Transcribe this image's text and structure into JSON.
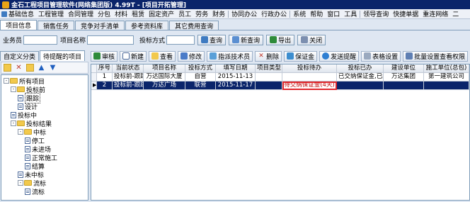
{
  "window": {
    "title": "金石工程项目管理软件(网络集团版) 4.99T - [项目开拓管理]"
  },
  "menu": [
    "基础信息",
    "工程管理",
    "合同管理",
    "分包",
    "材料",
    "租赁",
    "固定资产",
    "员工",
    "劳务",
    "财务",
    "协同办公",
    "行政办公",
    "系统",
    "帮助",
    "窗口",
    "工具",
    "领导查询",
    "快捷单据",
    "重连网络",
    "二"
  ],
  "main_tabs": [
    "项目信息",
    "销售任务",
    "竞争对手清单",
    "参考资料库",
    "其它费用查询"
  ],
  "search": {
    "staff_label": "业务员",
    "project_name_label": "项目名称",
    "bid_method_label": "投标方式",
    "query_button": "查询",
    "new_query_button": "新查询",
    "export_button": "导出",
    "close_button": "关闭"
  },
  "left_tabs": [
    "自定义分类",
    "待提醒的项目"
  ],
  "tree": [
    {
      "label": "所有项目",
      "level": 0,
      "type": "folder",
      "expander": "-"
    },
    {
      "label": "投标前",
      "level": 1,
      "type": "folder",
      "expander": "-"
    },
    {
      "label": "跟踪",
      "level": 2,
      "type": "doc",
      "selected": true
    },
    {
      "label": "设计",
      "level": 2,
      "type": "doc"
    },
    {
      "label": "投标中",
      "level": 1,
      "type": "doc"
    },
    {
      "label": "投标结果",
      "level": 1,
      "type": "folder",
      "expander": "-"
    },
    {
      "label": "中标",
      "level": 2,
      "type": "folder",
      "expander": "-"
    },
    {
      "label": "停工",
      "level": 3,
      "type": "doc"
    },
    {
      "label": "未进场",
      "level": 3,
      "type": "doc"
    },
    {
      "label": "正常施工",
      "level": 3,
      "type": "doc"
    },
    {
      "label": "结算",
      "level": 3,
      "type": "doc"
    },
    {
      "label": "未中标",
      "level": 2,
      "type": "doc"
    },
    {
      "label": "流标",
      "level": 2,
      "type": "folder",
      "expander": "-"
    },
    {
      "label": "流标",
      "level": 3,
      "type": "doc"
    }
  ],
  "toolbar": [
    "审核",
    "新建",
    "查看",
    "修改",
    "指派技术员",
    "删除",
    "保证金",
    "发送提醒",
    "表格设置",
    "批量设置查看权限"
  ],
  "grid": {
    "columns": [
      "序号",
      "当前状态",
      "项目名称",
      "投标方式",
      "填写日期",
      "项目类型",
      "投标待办",
      "投标已办",
      "建设单位",
      "施工单位(总包)"
    ],
    "rows": [
      [
        "1",
        "投标前-跟踪",
        "万达国际大厦",
        "自营",
        "2015-11-13",
        "",
        "",
        "已交纳保证金,已经",
        "万达集团",
        "第一建筑公司"
      ],
      [
        "2",
        "投标前-跟踪",
        "万达广场",
        "联营",
        "2015-11-17",
        "",
        "待交纳保证金(4天)",
        "",
        "",
        ""
      ]
    ],
    "selected_row": 1,
    "highlight_cell": "待交纳保证金(4天)"
  },
  "colors": {
    "title_bg": "#0a246a",
    "selection": "#0a246a",
    "highlight_border": "#e0262b"
  }
}
